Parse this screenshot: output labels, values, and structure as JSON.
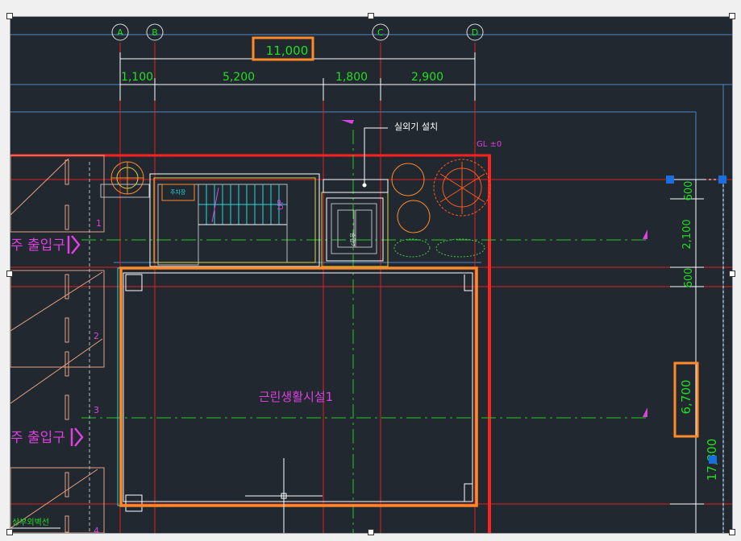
{
  "grid_bubbles": [
    "A",
    "B",
    "C",
    "D"
  ],
  "dims_top": {
    "overall": "11,000",
    "segments": [
      "1,100",
      "5,200",
      "1,800",
      "2,900"
    ]
  },
  "dims_right": {
    "top": "600",
    "middle": "2,100",
    "bottom": "600",
    "room": "6,700",
    "total": "17,800"
  },
  "annotations": {
    "outdoor_unit": "실외기 설치",
    "gl": "GL ±0",
    "stair_up": "UP",
    "stair_small": "주차장",
    "elevator": "승강기",
    "room_name": "근린생활시설1",
    "entrance_1": "주 출입구",
    "entrance_2": "주 출입구",
    "bottom_label": "상부외벽선"
  },
  "row_numbers": [
    "1",
    "2",
    "3",
    "4"
  ],
  "colors": {
    "background": "#212830",
    "highlight": "#ff8a2a",
    "dimension_text": "#22dd22",
    "magenta": "#e040e0",
    "red_line": "#ff2020",
    "grid_blue": "#4a88c8",
    "selection_grip": "#1a6fe0"
  }
}
